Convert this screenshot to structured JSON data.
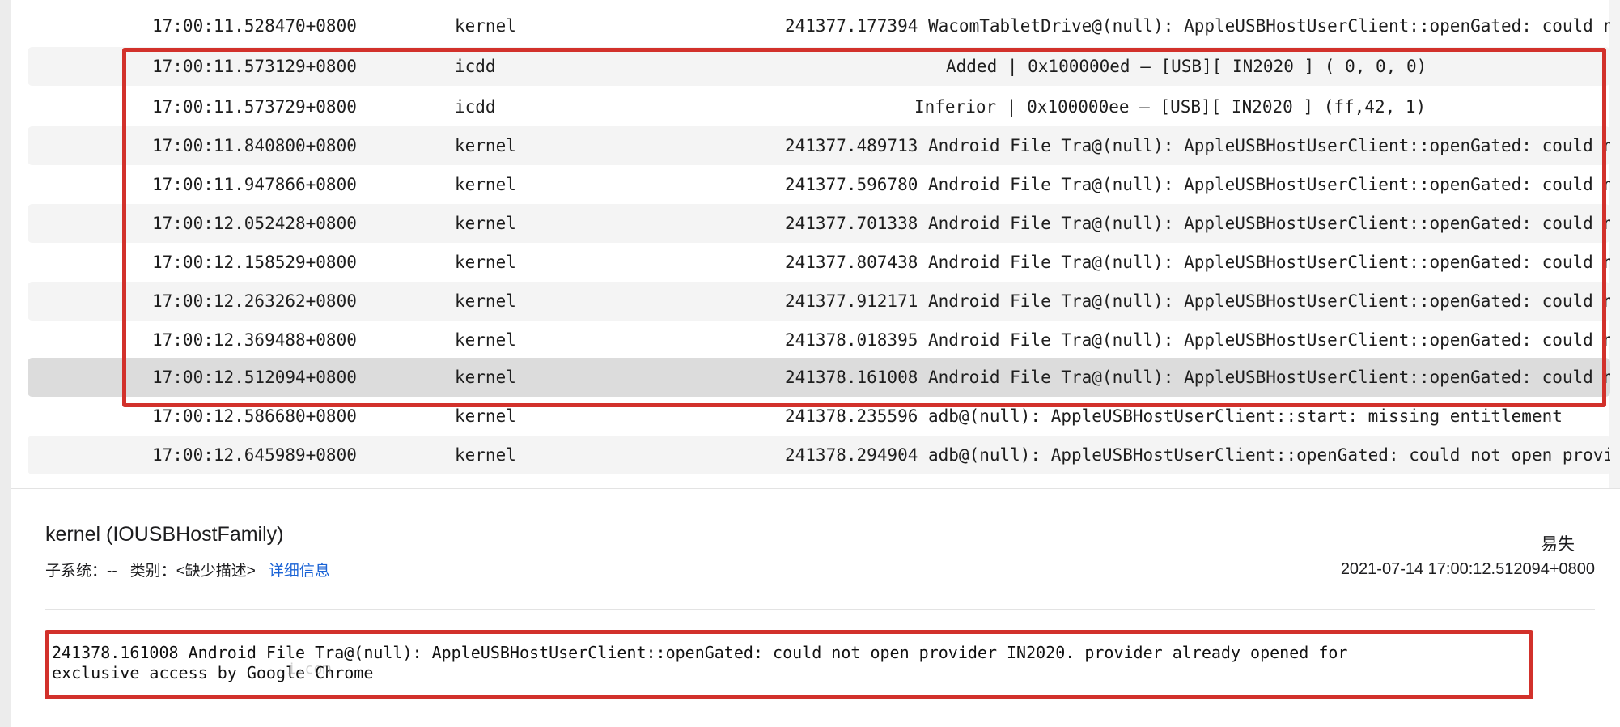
{
  "log_rows": [
    {
      "time": "17:00:11.528470+0800",
      "process": "kernel",
      "message": "241377.177394 WacomTabletDrive@(null): AppleUSBHostUserClient::openGated: could not open provider"
    },
    {
      "time": "17:00:11.573129+0800",
      "process": "icdd",
      "message": "Added | 0x100000ed – [USB][               IN2020 ] ( 0, 0, 0)"
    },
    {
      "time": "17:00:11.573729+0800",
      "process": "icdd",
      "message": "Inferior | 0x100000ee – [USB][               IN2020 ] (ff,42, 1)"
    },
    {
      "time": "17:00:11.840800+0800",
      "process": "kernel",
      "message": "241377.489713 Android File Tra@(null): AppleUSBHostUserClient::openGated: could not open provider"
    },
    {
      "time": "17:00:11.947866+0800",
      "process": "kernel",
      "message": "241377.596780 Android File Tra@(null): AppleUSBHostUserClient::openGated: could not open provider"
    },
    {
      "time": "17:00:12.052428+0800",
      "process": "kernel",
      "message": "241377.701338 Android File Tra@(null): AppleUSBHostUserClient::openGated: could not open provider"
    },
    {
      "time": "17:00:12.158529+0800",
      "process": "kernel",
      "message": "241377.807438 Android File Tra@(null): AppleUSBHostUserClient::openGated: could not open provider"
    },
    {
      "time": "17:00:12.263262+0800",
      "process": "kernel",
      "message": "241377.912171 Android File Tra@(null): AppleUSBHostUserClient::openGated: could not open provider"
    },
    {
      "time": "17:00:12.369488+0800",
      "process": "kernel",
      "message": "241378.018395 Android File Tra@(null): AppleUSBHostUserClient::openGated: could not open provider"
    },
    {
      "time": "17:00:12.512094+0800",
      "process": "kernel",
      "message": "241378.161008 Android File Tra@(null): AppleUSBHostUserClient::openGated: could not open provider"
    },
    {
      "time": "17:00:12.586680+0800",
      "process": "kernel",
      "message": "241378.235596 adb@(null): AppleUSBHostUserClient::start: missing entitlement"
    },
    {
      "time": "17:00:12.645989+0800",
      "process": "kernel",
      "message": "241378.294904 adb@(null): AppleUSBHostUserClient::openGated: could not open provider"
    }
  ],
  "detail": {
    "title": "kernel (IOUSBHostFamily)",
    "top_right": "易失",
    "subsystem_label": "子系统：",
    "subsystem_value": "--",
    "category_label": "类别：",
    "category_value": "<缺少描述>",
    "more_info_link": "详细信息",
    "datetime": "2021-07-14 17:00:12.512094+0800",
    "message": "241378.161008 Android File Tra@(null): AppleUSBHostUserClient::openGated: could not open provider IN2020. provider already opened for\nexclusive access by Google Chrome",
    "watermark": "i.com"
  },
  "colors": {
    "highlight_border": "#d2312b",
    "link": "#1a63d6",
    "row_alt": "#f4f4f4",
    "row_selected": "#dcdcdc"
  }
}
